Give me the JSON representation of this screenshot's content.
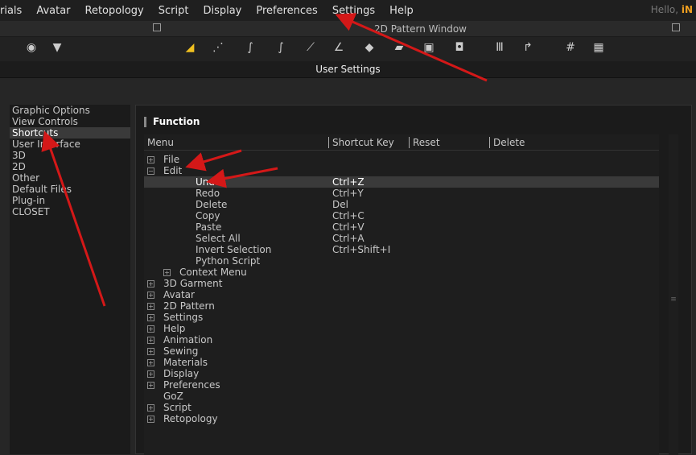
{
  "menubar": {
    "items": [
      "rials",
      "Avatar",
      "Retopology",
      "Script",
      "Display",
      "Preferences",
      "Settings",
      "Help"
    ],
    "greeting": "Hello,",
    "user": "iN"
  },
  "pattern_window": {
    "title": "2D Pattern Window"
  },
  "dialog": {
    "title": "User Settings"
  },
  "categories": [
    "Graphic Options",
    "View Controls",
    "Shortcuts",
    "User Interface",
    "3D",
    "2D",
    "Other",
    "Default Files",
    "Plug-in",
    "CLOSET"
  ],
  "selected_category": "Shortcuts",
  "function": {
    "heading": "Function",
    "columns": [
      "Menu",
      "Shortcut Key",
      "Reset",
      "Delete"
    ],
    "rows": [
      {
        "label": "File",
        "level": 0,
        "exp": "+",
        "key": ""
      },
      {
        "label": "Edit",
        "level": 0,
        "exp": "-",
        "key": ""
      },
      {
        "label": "Undo",
        "level": 1,
        "key": "Ctrl+Z",
        "sel": true
      },
      {
        "label": "Redo",
        "level": 1,
        "key": "Ctrl+Y"
      },
      {
        "label": "Delete",
        "level": 1,
        "key": "Del"
      },
      {
        "label": "Copy",
        "level": 1,
        "key": "Ctrl+C"
      },
      {
        "label": "Paste",
        "level": 1,
        "key": "Ctrl+V"
      },
      {
        "label": "Select All",
        "level": 1,
        "key": "Ctrl+A"
      },
      {
        "label": "Invert Selection",
        "level": 1,
        "key": "Ctrl+Shift+I"
      },
      {
        "label": "Python Script",
        "level": 1,
        "key": ""
      },
      {
        "label": "Context Menu",
        "level": 1,
        "exp": "+",
        "key": ""
      },
      {
        "label": "3D Garment",
        "level": 0,
        "exp": "+",
        "key": ""
      },
      {
        "label": "Avatar",
        "level": 0,
        "exp": "+",
        "key": ""
      },
      {
        "label": "2D Pattern",
        "level": 0,
        "exp": "+",
        "key": ""
      },
      {
        "label": "Settings",
        "level": 0,
        "exp": "+",
        "key": ""
      },
      {
        "label": "Help",
        "level": 0,
        "exp": "+",
        "key": ""
      },
      {
        "label": "Animation",
        "level": 0,
        "exp": "+",
        "key": ""
      },
      {
        "label": "Sewing",
        "level": 0,
        "exp": "+",
        "key": ""
      },
      {
        "label": "Materials",
        "level": 0,
        "exp": "+",
        "key": ""
      },
      {
        "label": "Display",
        "level": 0,
        "exp": "+",
        "key": ""
      },
      {
        "label": "Preferences",
        "level": 0,
        "exp": "+",
        "key": ""
      },
      {
        "label": "GoZ",
        "level": 0,
        "key": ""
      },
      {
        "label": "Script",
        "level": 0,
        "exp": "+",
        "key": ""
      },
      {
        "label": "Retopology",
        "level": 0,
        "exp": "+",
        "key": ""
      }
    ]
  },
  "annotation_color": "#d41818"
}
